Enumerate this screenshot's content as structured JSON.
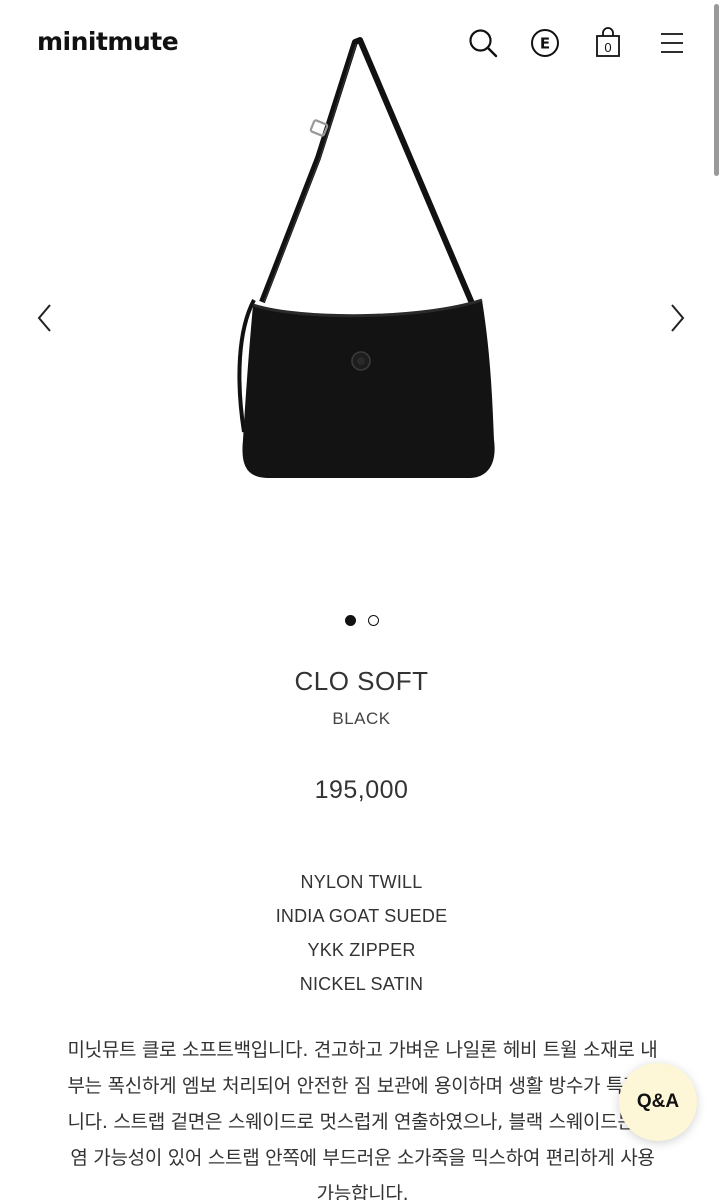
{
  "header": {
    "logo": "minitmute",
    "cart_count": "0",
    "exchange_icon_letter": "E"
  },
  "gallery": {
    "total_images": 2,
    "active_index": 1
  },
  "product": {
    "name": "CLO SOFT",
    "color": "BLACK",
    "price": "195,000",
    "materials": [
      "NYLON TWILL",
      "INDIA GOAT SUEDE",
      "YKK ZIPPER",
      "NICKEL SATIN"
    ],
    "description": "미닛뮤트 클로 소프트백입니다. 견고하고 가벼운 나일론 헤비 트윌 소재로 내부는 폭신하게 엠보 처리되어 안전한 짐 보관에 용이하며 생활 방수가 특징입니다. 스트랩 겉면은 스웨이드로 멋스럽게 연출하였으나, 블랙 스웨이드는 이염 가능성이 있어 스트랩 안쪽에 부드러운 소가죽을 믹스하여 편리하게 사용 가능합니다."
  },
  "qa_button": {
    "label": "Q&A"
  },
  "colors": {
    "accent_bg": "#fdf7d7",
    "text": "#222222"
  }
}
